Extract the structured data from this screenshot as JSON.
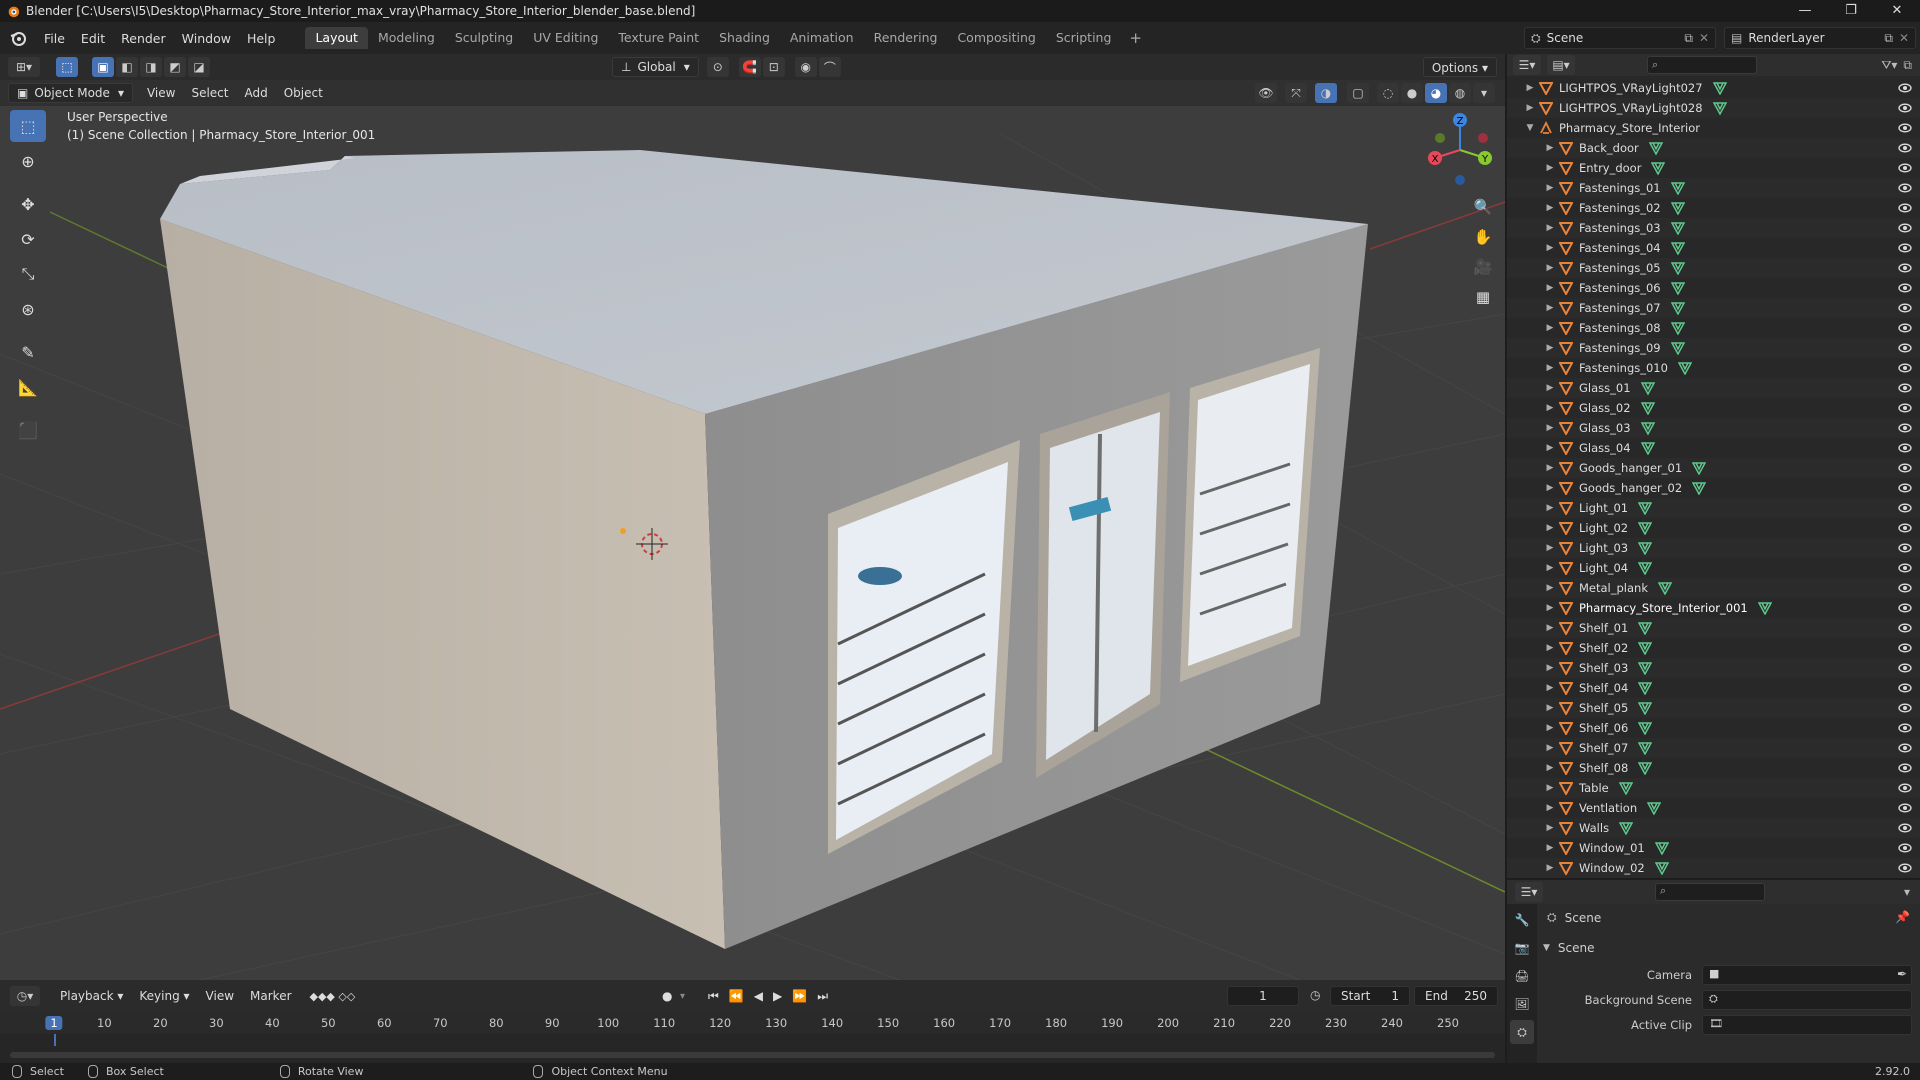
{
  "window": {
    "title": "Blender [C:\\Users\\I5\\Desktop\\Pharmacy_Store_Interior_max_vray\\Pharmacy_Store_Interior_blender_base.blend]",
    "minimize": "—",
    "restore": "❐",
    "close": "✕"
  },
  "menu": [
    "File",
    "Edit",
    "Render",
    "Window",
    "Help"
  ],
  "workspaces": {
    "tabs": [
      "Layout",
      "Modeling",
      "Sculpting",
      "UV Editing",
      "Texture Paint",
      "Shading",
      "Animation",
      "Rendering",
      "Compositing",
      "Scripting"
    ],
    "active": "Layout",
    "add": "+"
  },
  "scene_selector": {
    "scene": "Scene",
    "view_layer": "RenderLayer"
  },
  "viewport": {
    "transform_orientation": "Global",
    "options": "Options",
    "mode": "Object Mode",
    "menus": [
      "View",
      "Select",
      "Add",
      "Object"
    ],
    "perspective_label": "User Perspective",
    "collection_label": "(1) Scene Collection | Pharmacy_Store_Interior_001",
    "gizmo": {
      "x": "X",
      "y": "Y",
      "z": "Z"
    }
  },
  "outliner": {
    "search_placeholder": "",
    "items": [
      {
        "name": "LIGHTPOS_VRayLight027",
        "type": "mesh",
        "indent": 0
      },
      {
        "name": "LIGHTPOS_VRayLight028",
        "type": "mesh",
        "indent": 0
      },
      {
        "name": "Pharmacy_Store_Interior",
        "type": "empty",
        "indent": 0,
        "expanded": true
      },
      {
        "name": "Back_door",
        "type": "mesh",
        "indent": 1
      },
      {
        "name": "Entry_door",
        "type": "mesh",
        "indent": 1
      },
      {
        "name": "Fastenings_01",
        "type": "mesh",
        "indent": 1
      },
      {
        "name": "Fastenings_02",
        "type": "mesh",
        "indent": 1
      },
      {
        "name": "Fastenings_03",
        "type": "mesh",
        "indent": 1
      },
      {
        "name": "Fastenings_04",
        "type": "mesh",
        "indent": 1
      },
      {
        "name": "Fastenings_05",
        "type": "mesh",
        "indent": 1
      },
      {
        "name": "Fastenings_06",
        "type": "mesh",
        "indent": 1
      },
      {
        "name": "Fastenings_07",
        "type": "mesh",
        "indent": 1
      },
      {
        "name": "Fastenings_08",
        "type": "mesh",
        "indent": 1
      },
      {
        "name": "Fastenings_09",
        "type": "mesh",
        "indent": 1
      },
      {
        "name": "Fastenings_010",
        "type": "mesh",
        "indent": 1
      },
      {
        "name": "Glass_01",
        "type": "mesh",
        "indent": 1
      },
      {
        "name": "Glass_02",
        "type": "mesh",
        "indent": 1
      },
      {
        "name": "Glass_03",
        "type": "mesh",
        "indent": 1
      },
      {
        "name": "Glass_04",
        "type": "mesh",
        "indent": 1
      },
      {
        "name": "Goods_hanger_01",
        "type": "mesh",
        "indent": 1
      },
      {
        "name": "Goods_hanger_02",
        "type": "mesh",
        "indent": 1
      },
      {
        "name": "Light_01",
        "type": "mesh",
        "indent": 1
      },
      {
        "name": "Light_02",
        "type": "mesh",
        "indent": 1
      },
      {
        "name": "Light_03",
        "type": "mesh",
        "indent": 1
      },
      {
        "name": "Light_04",
        "type": "mesh",
        "indent": 1
      },
      {
        "name": "Metal_plank",
        "type": "mesh",
        "indent": 1
      },
      {
        "name": "Pharmacy_Store_Interior_001",
        "type": "mesh",
        "indent": 1,
        "selected": true
      },
      {
        "name": "Shelf_01",
        "type": "mesh",
        "indent": 1
      },
      {
        "name": "Shelf_02",
        "type": "mesh",
        "indent": 1
      },
      {
        "name": "Shelf_03",
        "type": "mesh",
        "indent": 1
      },
      {
        "name": "Shelf_04",
        "type": "mesh",
        "indent": 1
      },
      {
        "name": "Shelf_05",
        "type": "mesh",
        "indent": 1
      },
      {
        "name": "Shelf_06",
        "type": "mesh",
        "indent": 1
      },
      {
        "name": "Shelf_07",
        "type": "mesh",
        "indent": 1
      },
      {
        "name": "Shelf_08",
        "type": "mesh",
        "indent": 1
      },
      {
        "name": "Table",
        "type": "mesh",
        "indent": 1
      },
      {
        "name": "Ventlation",
        "type": "mesh",
        "indent": 1
      },
      {
        "name": "Walls",
        "type": "mesh",
        "indent": 1
      },
      {
        "name": "Window_01",
        "type": "mesh",
        "indent": 1
      },
      {
        "name": "Window_02",
        "type": "mesh",
        "indent": 1
      }
    ]
  },
  "properties": {
    "breadcrumb": "Scene",
    "panel": "Scene",
    "fields": [
      {
        "label": "Camera",
        "value": ""
      },
      {
        "label": "Background Scene",
        "value": ""
      },
      {
        "label": "Active Clip",
        "value": ""
      }
    ]
  },
  "timeline": {
    "menus": [
      "Playback",
      "Keying",
      "View",
      "Marker"
    ],
    "current_frame": "1",
    "start_label": "Start",
    "start": "1",
    "end_label": "End",
    "end": "250",
    "ticks": [
      "1",
      "10",
      "20",
      "30",
      "40",
      "50",
      "60",
      "70",
      "80",
      "90",
      "100",
      "110",
      "120",
      "130",
      "140",
      "150",
      "160",
      "170",
      "180",
      "190",
      "200",
      "210",
      "220",
      "230",
      "240",
      "250"
    ]
  },
  "statusbar": {
    "items": [
      "Select",
      "Box Select",
      "Rotate View",
      "Object Context Menu"
    ],
    "version": "2.92.0"
  },
  "colors": {
    "accent": "#4772b3",
    "object_orange": "#e8833a",
    "mesh_green": "#5fc88c",
    "axis_x": "#e8485a",
    "axis_y": "#8ac830",
    "axis_z": "#3a86e0"
  }
}
